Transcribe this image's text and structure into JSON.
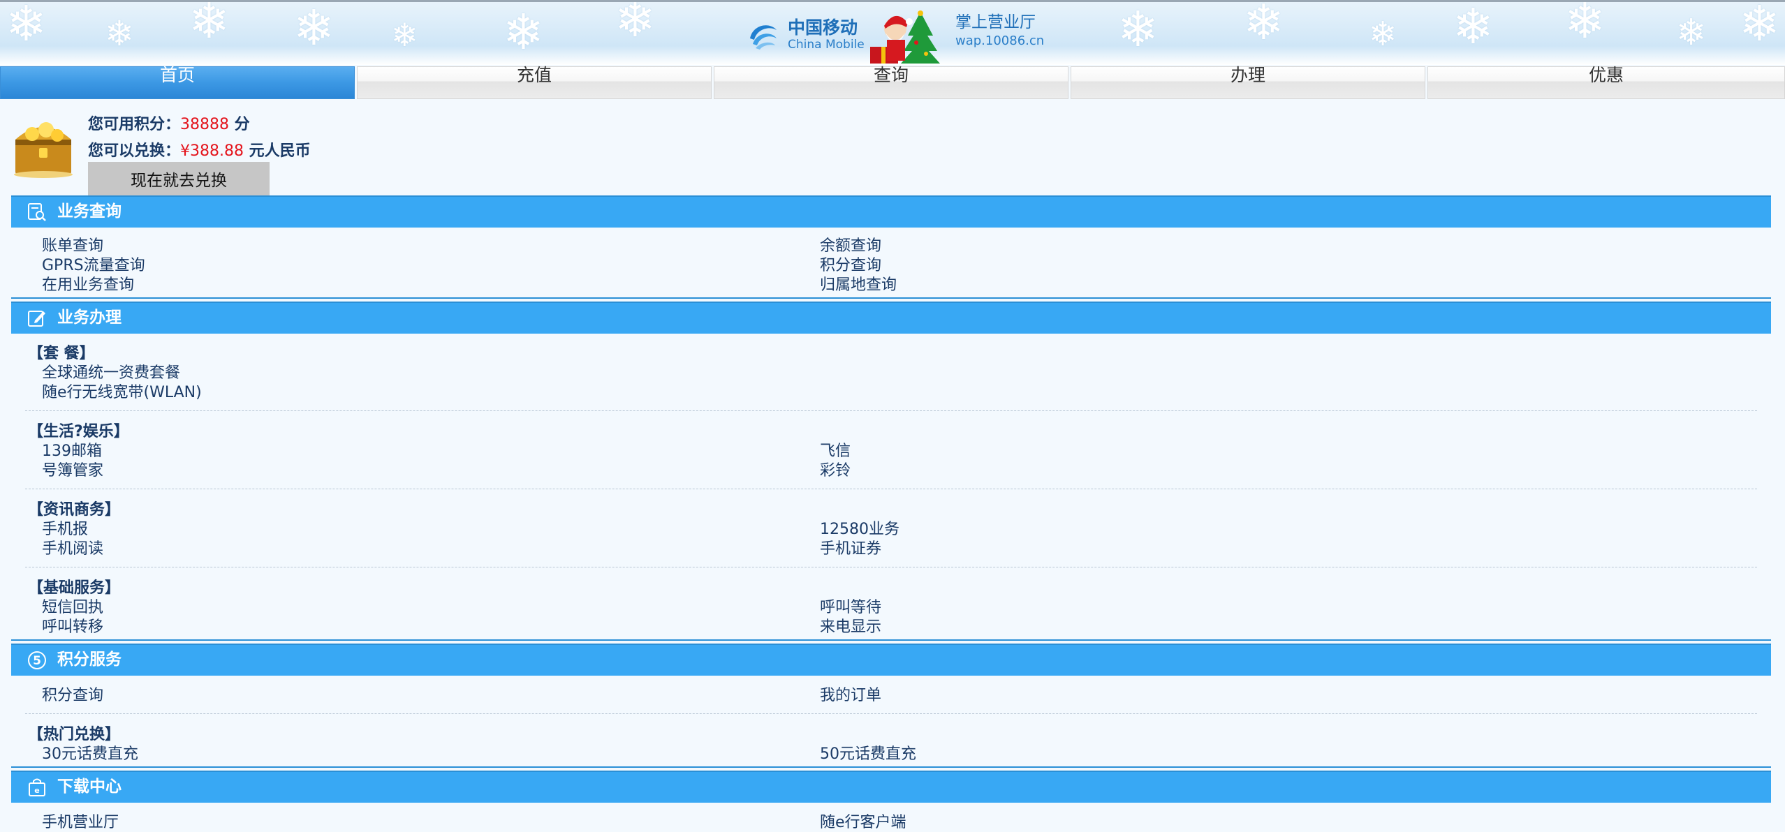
{
  "header": {
    "brand_cn": "中国移动",
    "brand_en": "China Mobile",
    "site_title": "掌上营业厅",
    "site_url": "wap.10086.cn"
  },
  "tabs": [
    {
      "label": "首页",
      "active": true
    },
    {
      "label": "充值",
      "active": false
    },
    {
      "label": "查询",
      "active": false
    },
    {
      "label": "办理",
      "active": false
    },
    {
      "label": "优惠",
      "active": false
    }
  ],
  "points": {
    "available_label": "您可用积分：",
    "available_value": "38888",
    "available_unit": " 分",
    "exchange_label": "您可以兑换：",
    "exchange_value": "¥388.88",
    "exchange_unit": " 元人民币",
    "redeem_button": "现在就去兑换"
  },
  "sections": {
    "query": {
      "title": "业务查询",
      "icon": "search-doc-icon",
      "items": [
        "账单查询",
        "余额查询",
        "GPRS流量查询",
        "积分查询",
        "在用业务查询",
        "归属地查询"
      ]
    },
    "handle": {
      "title": "业务办理",
      "icon": "edit-icon",
      "groups": [
        {
          "name": "【套 餐】",
          "items": [
            "全球通统一资费套餐",
            "随e行无线宽带(WLAN)"
          ]
        },
        {
          "name": "【生活?娱乐】",
          "items": [
            "139邮箱",
            "飞信",
            "号簿管家",
            "彩铃"
          ]
        },
        {
          "name": "【资讯商务】",
          "items": [
            "手机报",
            "12580业务",
            "手机阅读",
            "手机证券"
          ]
        },
        {
          "name": "【基础服务】",
          "items": [
            "短信回执",
            "呼叫等待",
            "呼叫转移",
            "来电显示"
          ]
        }
      ]
    },
    "points_service": {
      "title": "积分服务",
      "icon": "points-coin-icon",
      "items": [
        "积分查询",
        "我的订单"
      ],
      "hot_group": {
        "name": "【热门兑换】",
        "items": [
          "30元话费直充",
          "50元话费直充"
        ]
      }
    },
    "download": {
      "title": "下载中心",
      "icon": "download-bag-icon",
      "items": [
        "手机营业厅",
        "随e行客户端"
      ]
    }
  },
  "colors": {
    "accent": "#38a8f4",
    "text": "#1a3a66",
    "highlight": "#e4141c",
    "background": "#f3f9fe"
  }
}
